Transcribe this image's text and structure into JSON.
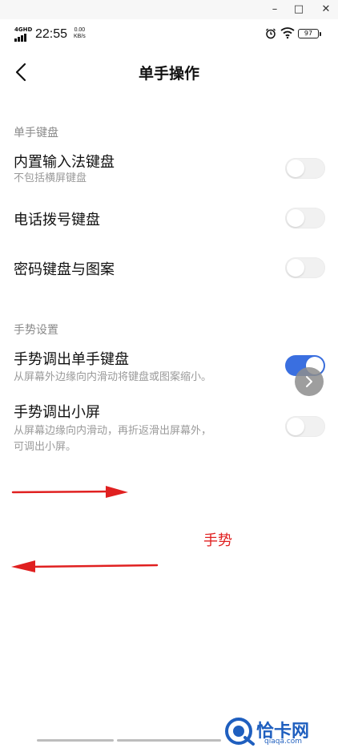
{
  "window_controls": {
    "minimize": "–",
    "maximize": "□",
    "close": "✕"
  },
  "status_bar": {
    "network": "4GHD",
    "time": "22:55",
    "speed_value": "0.00",
    "speed_unit": "KB/s",
    "battery": "97",
    "icons": [
      "signal-icon",
      "alarm-icon",
      "wifi-icon",
      "battery-icon"
    ]
  },
  "header": {
    "title": "单手操作",
    "back_icon": "chevron-left-icon"
  },
  "sections": [
    {
      "label": "单手键盘",
      "items": [
        {
          "title": "内置输入法键盘",
          "subtitle": "不包括横屏键盘",
          "enabled": false
        },
        {
          "title": "电话拨号键盘",
          "enabled": false
        },
        {
          "title": "密码键盘与图案",
          "enabled": false
        }
      ]
    },
    {
      "label": "手势设置",
      "items": [
        {
          "title": "手势调出单手键盘",
          "subtitle": "从屏幕外边缘向内滑动将键盘或图案缩小。",
          "enabled": true
        },
        {
          "title": "手势调出小屏",
          "subtitle_lines": [
            "从屏幕边缘向内滑动，再折返滑出屏幕外，",
            "可调出小屏。"
          ],
          "enabled": false
        }
      ]
    }
  ],
  "annotation": {
    "label": "手势",
    "color": "#e02020"
  },
  "watermark": {
    "text": "恰卡网",
    "url": "qiaqa.com"
  },
  "colors": {
    "accent": "#3a6fe0",
    "annotation": "#e02020"
  }
}
